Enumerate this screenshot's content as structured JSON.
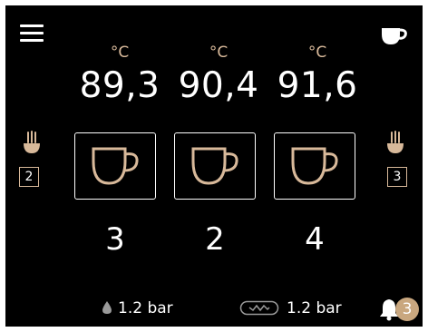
{
  "temperatures": [
    {
      "unit": "°C",
      "value": "89,3"
    },
    {
      "unit": "°C",
      "value": "90,4"
    },
    {
      "unit": "°C",
      "value": "91,6"
    }
  ],
  "groups": [
    {
      "count": "3"
    },
    {
      "count": "2"
    },
    {
      "count": "4"
    }
  ],
  "steam": {
    "left_value": "2",
    "right_value": "3"
  },
  "status": {
    "water_pressure": "1.2 bar",
    "pump_pressure": "1.2 bar"
  },
  "notifications": {
    "count": "3"
  },
  "colors": {
    "accent": "#d8b99a",
    "badge": "#c9a77f",
    "background": "#000000"
  },
  "icons": [
    "menu-icon",
    "cup-icon",
    "steam-wand-icon",
    "water-drop-icon",
    "pump-icon",
    "bell-icon"
  ]
}
